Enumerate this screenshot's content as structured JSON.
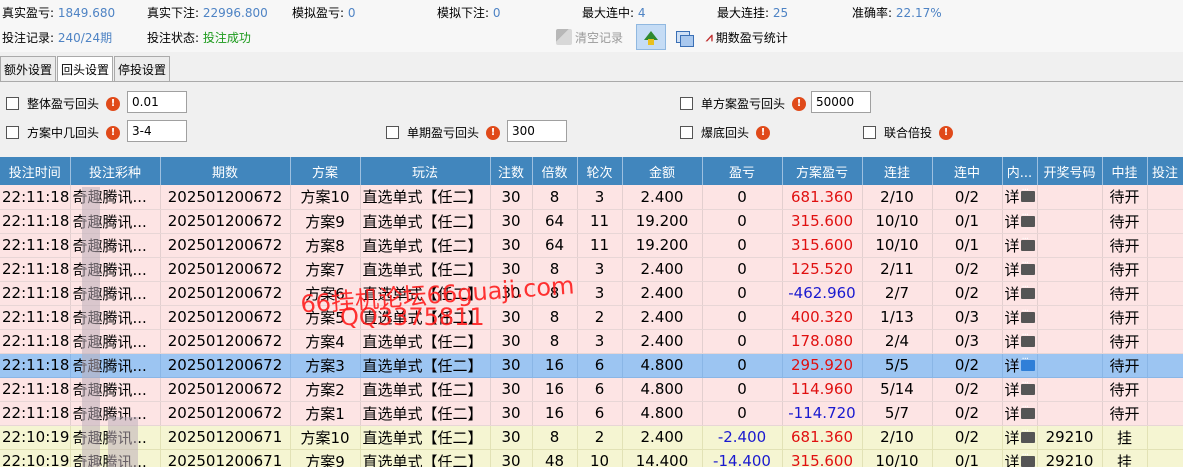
{
  "stats": {
    "real_profit_label": "真实盈亏:",
    "real_profit": "1849.680",
    "real_bet_label": "真实下注:",
    "real_bet": "22996.800",
    "sim_profit_label": "模拟盈亏:",
    "sim_profit": "0",
    "sim_bet_label": "模拟下注:",
    "sim_bet": "0",
    "max_win_streak_label": "最大连中:",
    "max_win_streak": "4",
    "max_loss_streak_label": "最大连挂:",
    "max_loss_streak": "25",
    "accuracy_label": "准确率:",
    "accuracy": "22.17%",
    "record_label": "投注记录:",
    "record": "240/24期",
    "status_label": "投注状态:",
    "status": "投注成功"
  },
  "toolbar": {
    "clear_label": "清空记录",
    "period_stats_label": "期数盈亏统计"
  },
  "tabs": [
    "额外设置",
    "回头设置",
    "停投设置"
  ],
  "settings": {
    "overall_label": "整体盈亏回头",
    "overall_value": "0.01",
    "single_plan_label": "单方案盈亏回头",
    "single_plan_value": "50000",
    "plan_hit_label": "方案中几回头",
    "plan_hit_value": "3-4",
    "single_period_label": "单期盈亏回头",
    "single_period_value": "300",
    "burst_label": "爆底回头",
    "joint_label": "联合倍投",
    "warn_glyph": "!"
  },
  "table": {
    "headers": [
      "投注时间",
      "投注彩种",
      "期数",
      "方案",
      "玩法",
      "注数",
      "倍数",
      "轮次",
      "金额",
      "盈亏",
      "方案盈亏",
      "连挂",
      "连中",
      "内...",
      "开奖号码",
      "中挂",
      "投注"
    ],
    "detail_text": "详",
    "rows": [
      {
        "time": "22:11:18",
        "lottery": "奇趣腾讯...",
        "period": "202501200672",
        "plan": "方案10",
        "play": "直选单式【任二】",
        "count": "30",
        "mult": "8",
        "round": "3",
        "amount": "2.400",
        "profit": "0",
        "plan_profit": "681.360",
        "loss_streak": "2/10",
        "win_streak": "0/2",
        "draw": "",
        "result": "待开",
        "style": "pink",
        "pp_color": "red",
        "p_color": ""
      },
      {
        "time": "22:11:18",
        "lottery": "奇趣腾讯...",
        "period": "202501200672",
        "plan": "方案9",
        "play": "直选单式【任二】",
        "count": "30",
        "mult": "64",
        "round": "11",
        "amount": "19.200",
        "profit": "0",
        "plan_profit": "315.600",
        "loss_streak": "10/10",
        "win_streak": "0/1",
        "draw": "",
        "result": "待开",
        "style": "pink",
        "pp_color": "red",
        "p_color": ""
      },
      {
        "time": "22:11:18",
        "lottery": "奇趣腾讯...",
        "period": "202501200672",
        "plan": "方案8",
        "play": "直选单式【任二】",
        "count": "30",
        "mult": "64",
        "round": "11",
        "amount": "19.200",
        "profit": "0",
        "plan_profit": "315.600",
        "loss_streak": "10/10",
        "win_streak": "0/1",
        "draw": "",
        "result": "待开",
        "style": "pink",
        "pp_color": "red",
        "p_color": ""
      },
      {
        "time": "22:11:18",
        "lottery": "奇趣腾讯...",
        "period": "202501200672",
        "plan": "方案7",
        "play": "直选单式【任二】",
        "count": "30",
        "mult": "8",
        "round": "3",
        "amount": "2.400",
        "profit": "0",
        "plan_profit": "125.520",
        "loss_streak": "2/11",
        "win_streak": "0/2",
        "draw": "",
        "result": "待开",
        "style": "pink",
        "pp_color": "red",
        "p_color": ""
      },
      {
        "time": "22:11:18",
        "lottery": "奇趣腾讯...",
        "period": "202501200672",
        "plan": "方案6",
        "play": "直选单式【任二】",
        "count": "30",
        "mult": "8",
        "round": "3",
        "amount": "2.400",
        "profit": "0",
        "plan_profit": "-462.960",
        "loss_streak": "2/7",
        "win_streak": "0/2",
        "draw": "",
        "result": "待开",
        "style": "pink",
        "pp_color": "blue",
        "p_color": ""
      },
      {
        "time": "22:11:18",
        "lottery": "奇趣腾讯...",
        "period": "202501200672",
        "plan": "方案5",
        "play": "直选单式【任二】",
        "count": "30",
        "mult": "8",
        "round": "2",
        "amount": "2.400",
        "profit": "0",
        "plan_profit": "400.320",
        "loss_streak": "1/13",
        "win_streak": "0/3",
        "draw": "",
        "result": "待开",
        "style": "pink",
        "pp_color": "red",
        "p_color": ""
      },
      {
        "time": "22:11:18",
        "lottery": "奇趣腾讯...",
        "period": "202501200672",
        "plan": "方案4",
        "play": "直选单式【任二】",
        "count": "30",
        "mult": "8",
        "round": "3",
        "amount": "2.400",
        "profit": "0",
        "plan_profit": "178.080",
        "loss_streak": "2/4",
        "win_streak": "0/3",
        "draw": "",
        "result": "待开",
        "style": "pink",
        "pp_color": "red",
        "p_color": ""
      },
      {
        "time": "22:11:18",
        "lottery": "奇趣腾讯...",
        "period": "202501200672",
        "plan": "方案3",
        "play": "直选单式【任二】",
        "count": "30",
        "mult": "16",
        "round": "6",
        "amount": "4.800",
        "profit": "0",
        "plan_profit": "295.920",
        "loss_streak": "5/5",
        "win_streak": "0/2",
        "draw": "",
        "result": "待开",
        "style": "selected",
        "pp_color": "red",
        "p_color": ""
      },
      {
        "time": "22:11:18",
        "lottery": "奇趣腾讯...",
        "period": "202501200672",
        "plan": "方案2",
        "play": "直选单式【任二】",
        "count": "30",
        "mult": "16",
        "round": "6",
        "amount": "4.800",
        "profit": "0",
        "plan_profit": "114.960",
        "loss_streak": "5/14",
        "win_streak": "0/2",
        "draw": "",
        "result": "待开",
        "style": "pink",
        "pp_color": "red",
        "p_color": ""
      },
      {
        "time": "22:11:18",
        "lottery": "奇趣腾讯...",
        "period": "202501200672",
        "plan": "方案1",
        "play": "直选单式【任二】",
        "count": "30",
        "mult": "16",
        "round": "6",
        "amount": "4.800",
        "profit": "0",
        "plan_profit": "-114.720",
        "loss_streak": "5/7",
        "win_streak": "0/2",
        "draw": "",
        "result": "待开",
        "style": "pink",
        "pp_color": "blue",
        "p_color": ""
      },
      {
        "time": "22:10:19",
        "lottery": "奇趣腾讯...",
        "period": "202501200671",
        "plan": "方案10",
        "play": "直选单式【任二】",
        "count": "30",
        "mult": "8",
        "round": "2",
        "amount": "2.400",
        "profit": "-2.400",
        "plan_profit": "681.360",
        "loss_streak": "2/10",
        "win_streak": "0/2",
        "draw": "29210",
        "result": "挂",
        "style": "yellow",
        "pp_color": "red",
        "p_color": "blue"
      },
      {
        "time": "22:10:19",
        "lottery": "奇趣腾讯...",
        "period": "202501200671",
        "plan": "方案9",
        "play": "直选单式【任二】",
        "count": "30",
        "mult": "48",
        "round": "10",
        "amount": "14.400",
        "profit": "-14.400",
        "plan_profit": "315.600",
        "loss_streak": "10/10",
        "win_streak": "0/1",
        "draw": "29210",
        "result": "挂",
        "style": "yellow",
        "pp_color": "red",
        "p_color": "blue"
      }
    ]
  },
  "watermark": {
    "line1": "66挂机论坛66guaji.com",
    "line2": "QQ3375811"
  },
  "colors": {
    "header_bg": "#4186bd",
    "pending_row": "#fde4e4",
    "settled_row": "#f5f5d2",
    "selected_row": "#9cc5f2",
    "positive": "#e01010",
    "negative": "#1a1ad0"
  }
}
